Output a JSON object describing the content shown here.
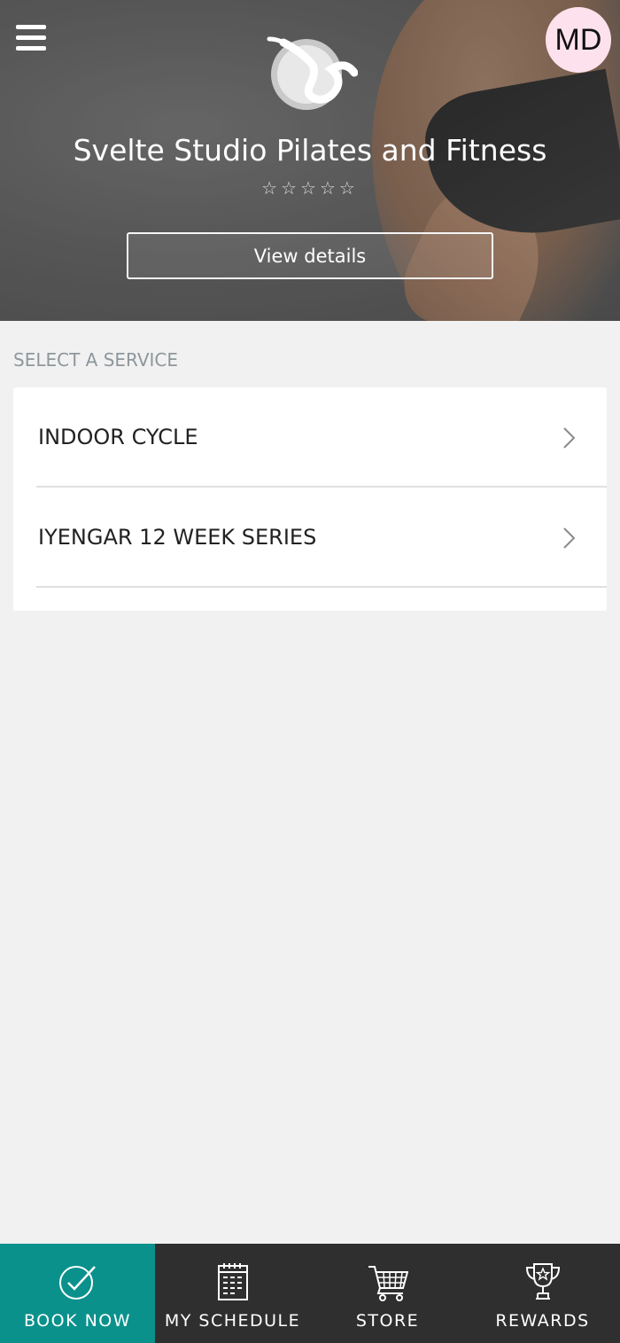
{
  "header": {
    "studio_name": "Svelte Studio Pilates and Fitness",
    "rating_stars": "☆☆☆☆☆",
    "view_details_label": "View details",
    "avatar_initials": "MD",
    "avatar_color": "#fde2ee"
  },
  "services": {
    "section_label": "SELECT A SERVICE",
    "items": [
      {
        "label": "INDOOR CYCLE"
      },
      {
        "label": "IYENGAR 12 WEEK SERIES"
      }
    ]
  },
  "tabbar": {
    "active_color": "#0a918c",
    "tabs": [
      {
        "label": "BOOK NOW",
        "icon": "check-circle-icon",
        "active": true
      },
      {
        "label": "MY SCHEDULE",
        "icon": "calendar-icon",
        "active": false
      },
      {
        "label": "STORE",
        "icon": "cart-icon",
        "active": false
      },
      {
        "label": "REWARDS",
        "icon": "trophy-icon",
        "active": false
      }
    ]
  }
}
